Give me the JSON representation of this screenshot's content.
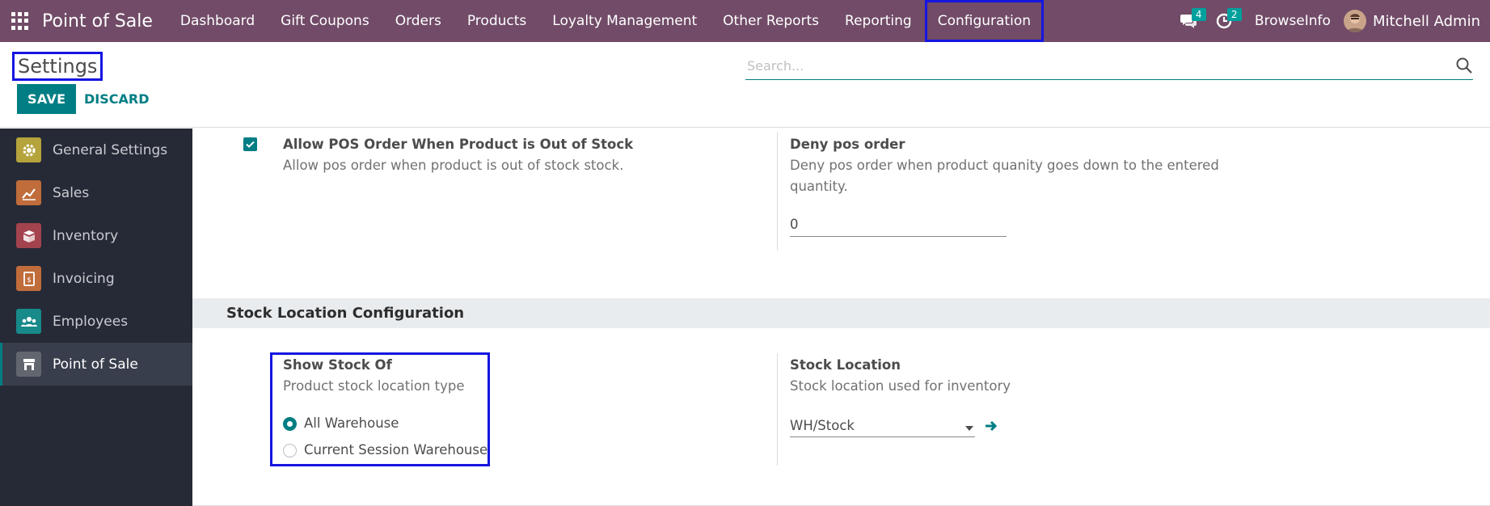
{
  "navbar": {
    "brand": "Point of Sale",
    "menu": [
      "Dashboard",
      "Gift Coupons",
      "Orders",
      "Products",
      "Loyalty Management",
      "Other Reports",
      "Reporting",
      "Configuration"
    ],
    "messages_count": "4",
    "activities_count": "2",
    "company": "BrowseInfo",
    "user": "Mitchell Admin"
  },
  "control": {
    "title": "Settings",
    "save_label": "SAVE",
    "discard_label": "DISCARD",
    "search_placeholder": "Search..."
  },
  "sidebar": {
    "items": [
      {
        "label": "General Settings",
        "icon": "gear-icon",
        "color": "#b5a33c"
      },
      {
        "label": "Sales",
        "icon": "chart-icon",
        "color": "#c06c3b"
      },
      {
        "label": "Inventory",
        "icon": "box-icon",
        "color": "#a3434d"
      },
      {
        "label": "Invoicing",
        "icon": "invoice-icon",
        "color": "#c06c3b"
      },
      {
        "label": "Employees",
        "icon": "people-icon",
        "color": "#188a8a"
      },
      {
        "label": "Point of Sale",
        "icon": "store-icon",
        "color": "#62676f"
      }
    ]
  },
  "main": {
    "allow_pos": {
      "title": "Allow POS Order When Product is Out of Stock",
      "desc": "Allow pos order when product is out of stock stock.",
      "checked": true
    },
    "deny_pos": {
      "title": "Deny pos order",
      "desc_line1": "Deny pos order when product quanity goes down to the entered",
      "desc_line2": "quantity.",
      "value": "0"
    },
    "section_title": "Stock Location Configuration",
    "show_stock": {
      "title": "Show Stock Of",
      "desc": "Product stock location type",
      "options": [
        "All Warehouse",
        "Current Session Warehouse"
      ],
      "selected": "All Warehouse"
    },
    "stock_location": {
      "title": "Stock Location",
      "desc": "Stock location used for inventory",
      "value": "WH/Stock"
    }
  },
  "colors": {
    "navbar": "#714b67",
    "primary": "#017e84",
    "sidebar": "#262a36",
    "highlight": "#1515e0"
  }
}
